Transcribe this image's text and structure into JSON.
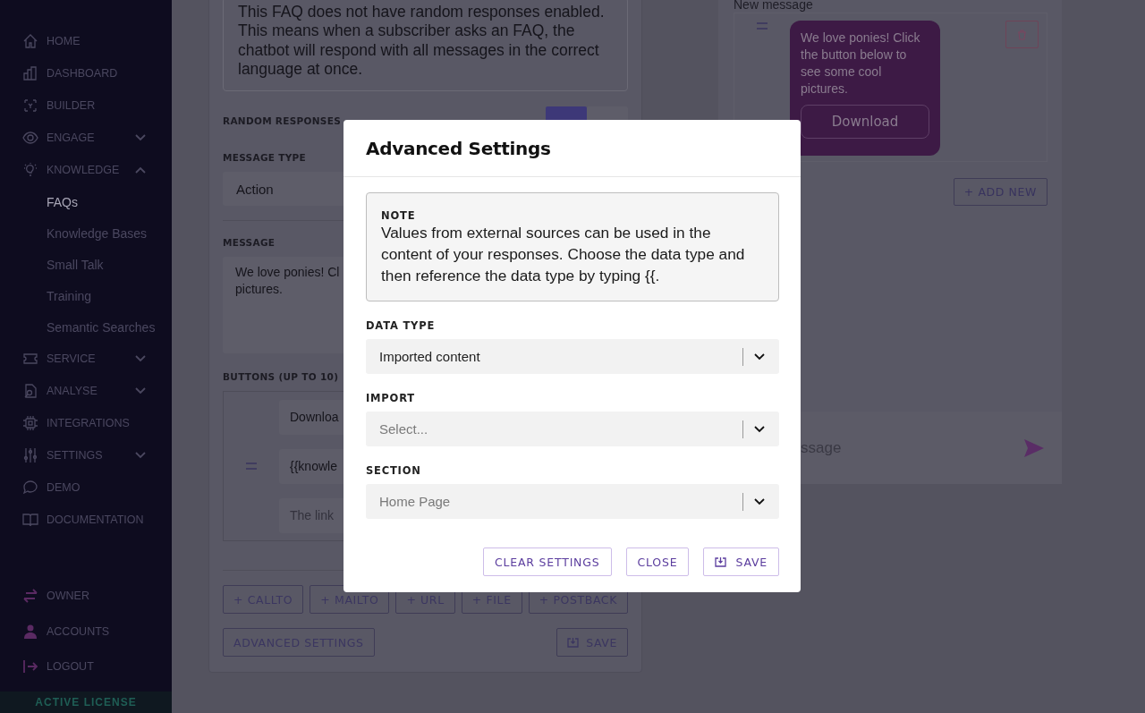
{
  "sidebar": {
    "items": [
      {
        "label": "HOME",
        "selected": false
      },
      {
        "label": "DASHBOARD",
        "selected": false
      },
      {
        "label": "BUILDER",
        "selected": false
      },
      {
        "label": "ENGAGE",
        "selected": false,
        "expanded": false
      },
      {
        "label": "KNOWLEDGE",
        "selected": false,
        "expanded": true,
        "children": [
          {
            "label": "FAQs",
            "selected": true
          },
          {
            "label": "Knowledge Bases",
            "selected": false
          },
          {
            "label": "Small Talk",
            "selected": false
          },
          {
            "label": "Training",
            "selected": false
          },
          {
            "label": "Semantic Searches",
            "selected": false
          }
        ]
      },
      {
        "label": "SERVICE",
        "selected": false,
        "expanded": false
      },
      {
        "label": "ANALYSE",
        "selected": false,
        "expanded": false
      },
      {
        "label": "INTEGRATIONS",
        "selected": false
      },
      {
        "label": "SETTINGS",
        "selected": false,
        "expanded": false
      },
      {
        "label": "DEMO",
        "selected": false
      },
      {
        "label": "DOCUMENTATION",
        "selected": false
      }
    ],
    "footer_items": [
      {
        "label": "OWNER"
      },
      {
        "label": "ACCOUNTS"
      },
      {
        "label": "LOGOUT"
      }
    ],
    "license": "ACTIVE LICENSE"
  },
  "faq_form": {
    "info_text": "This FAQ does not have random responses enabled. This means when a subscriber asks an FAQ, the chatbot will respond with all messages in the correct language at once.",
    "random_responses": {
      "label": "RANDOM RESPONSES",
      "toggle": [
        {
          "selected": true
        },
        {
          "selected": false
        }
      ]
    },
    "message_type": {
      "label": "MESSAGE TYPE",
      "value": "Action"
    },
    "message": {
      "label": "MESSAGE",
      "lines": [
        "We love ponies! Cl",
        "pictures."
      ]
    },
    "buttons_section": {
      "label": "BUTTONS (UP TO 10)",
      "fields": [
        {
          "value": "Downloa"
        },
        {
          "value": "{{knowle"
        },
        {
          "placeholder": "The link"
        }
      ]
    },
    "add_buttons": [
      "+ CALLTO",
      "+ MAILTO",
      "+ URL",
      "+ FILE",
      "+ POSTBACK"
    ],
    "advanced_button": "ADVANCED SETTINGS",
    "save_button": "SAVE"
  },
  "preview": {
    "title": "New message",
    "bubble_text": "We love ponies! Click the button below to see some cool pictures.",
    "bubble_button": "Download",
    "add_new": "+ ADD NEW",
    "composer_placeholder": "ssage"
  },
  "modal": {
    "title": "Advanced Settings",
    "note_label": "NOTE",
    "note_text": "Values from external sources can be used in the content of your responses. Choose the data type and then reference the data type by typing {{.",
    "fields": [
      {
        "label": "DATA TYPE",
        "value": "Imported content"
      },
      {
        "label": "IMPORT",
        "placeholder": "Select..."
      },
      {
        "label": "SECTION",
        "placeholder": "Home Page"
      }
    ],
    "buttons": [
      {
        "label": "CLEAR SETTINGS",
        "kind": "plain"
      },
      {
        "label": "CLOSE",
        "kind": "plain"
      },
      {
        "label": "SAVE",
        "kind": "save"
      }
    ]
  }
}
